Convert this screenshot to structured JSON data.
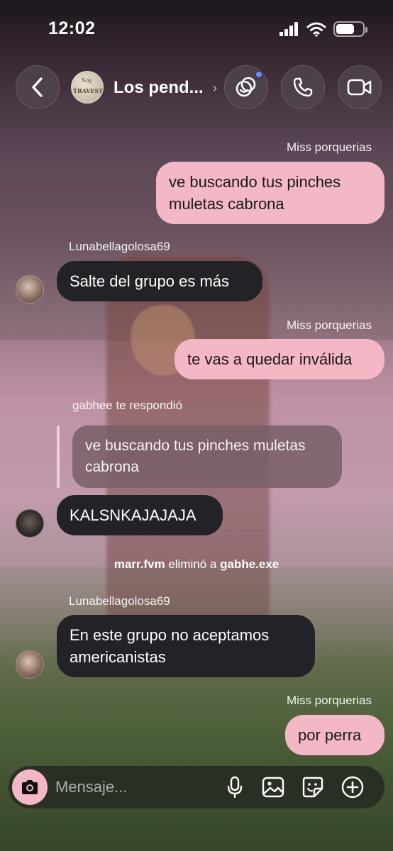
{
  "status_bar": {
    "time": "12:02",
    "battery_level": 0.7
  },
  "header": {
    "title": "Los pend...",
    "avatar_text": [
      "Soy",
      "TRAVESTI"
    ],
    "icons": [
      "back-chevron-icon",
      "chevron-right-icon",
      "effects-icon",
      "phone-icon",
      "video-camera-icon"
    ]
  },
  "messages": [
    {
      "sender": "Miss porquerias",
      "text": "ve buscando tus pinches muletas cabrona",
      "mine": true
    },
    {
      "sender": "Lunabellagolosa69",
      "text": "Salte del grupo es más",
      "mine": false
    },
    {
      "sender": "Miss porquerias",
      "text": "te vas a quedar inválida",
      "mine": true
    },
    {
      "reply_note": "gabhee te respondió",
      "quoted": "ve buscando tus pinches muletas cabrona",
      "text": "KALSNKAJAJAJA",
      "mine": false
    },
    {
      "system": {
        "actor": "marr.fvm",
        "action": "eliminó a",
        "target": "gabhe.exe"
      }
    },
    {
      "sender": "Lunabellagolosa69",
      "text": "En este grupo no aceptamos americanistas",
      "mine": false
    },
    {
      "sender": "Miss porquerias",
      "text": "por perra",
      "mine": true
    }
  ],
  "composer": {
    "placeholder": "Mensaje...",
    "icons": [
      "camera-icon",
      "microphone-icon",
      "gallery-icon",
      "sticker-icon",
      "plus-icon"
    ],
    "accent": "#f4b7c6"
  },
  "colors": {
    "mine_bubble": "#f4b7c6",
    "their_bubble": "#232226",
    "notification_dot": "#6d8cff"
  }
}
